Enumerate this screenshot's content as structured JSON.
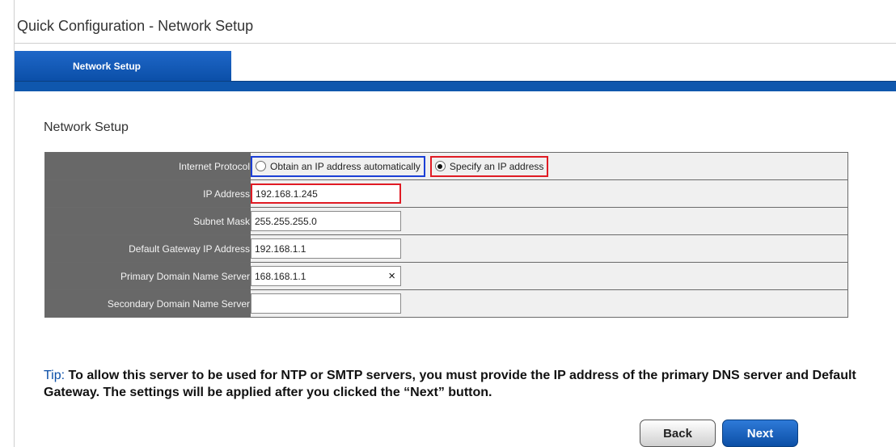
{
  "header": {
    "title": "Quick Configuration - Network Setup"
  },
  "tabs": [
    {
      "label": "Network Setup",
      "active": true
    }
  ],
  "section": {
    "title": "Network Setup"
  },
  "form": {
    "internet_protocol": {
      "label": "Internet Protocol",
      "options": [
        {
          "label": "Obtain an IP address automatically",
          "selected": false
        },
        {
          "label": "Specify an IP address",
          "selected": true
        }
      ]
    },
    "ip_address": {
      "label": "IP Address",
      "value": "192.168.1.245"
    },
    "subnet_mask": {
      "label": "Subnet Mask",
      "value": "255.255.255.0"
    },
    "gateway": {
      "label": "Default Gateway IP Address",
      "value": "192.168.1.1"
    },
    "primary_dns": {
      "label": "Primary Domain Name Server",
      "value": "168.168.1.1",
      "clear_icon": "×"
    },
    "secondary_dns": {
      "label": "Secondary Domain Name Server",
      "value": ""
    }
  },
  "tip": {
    "label": "Tip:",
    "text": "To allow this server to be used for NTP or SMTP servers, you must provide the IP address of the primary DNS server and Default Gateway. The settings will be applied after you clicked the “Next” button."
  },
  "buttons": {
    "back": "Back",
    "next": "Next"
  },
  "colors": {
    "tab_blue": "#0b4fa8",
    "label_cell": "#686868",
    "highlight_blue": "#1b3fd6",
    "highlight_red": "#e01b24"
  }
}
